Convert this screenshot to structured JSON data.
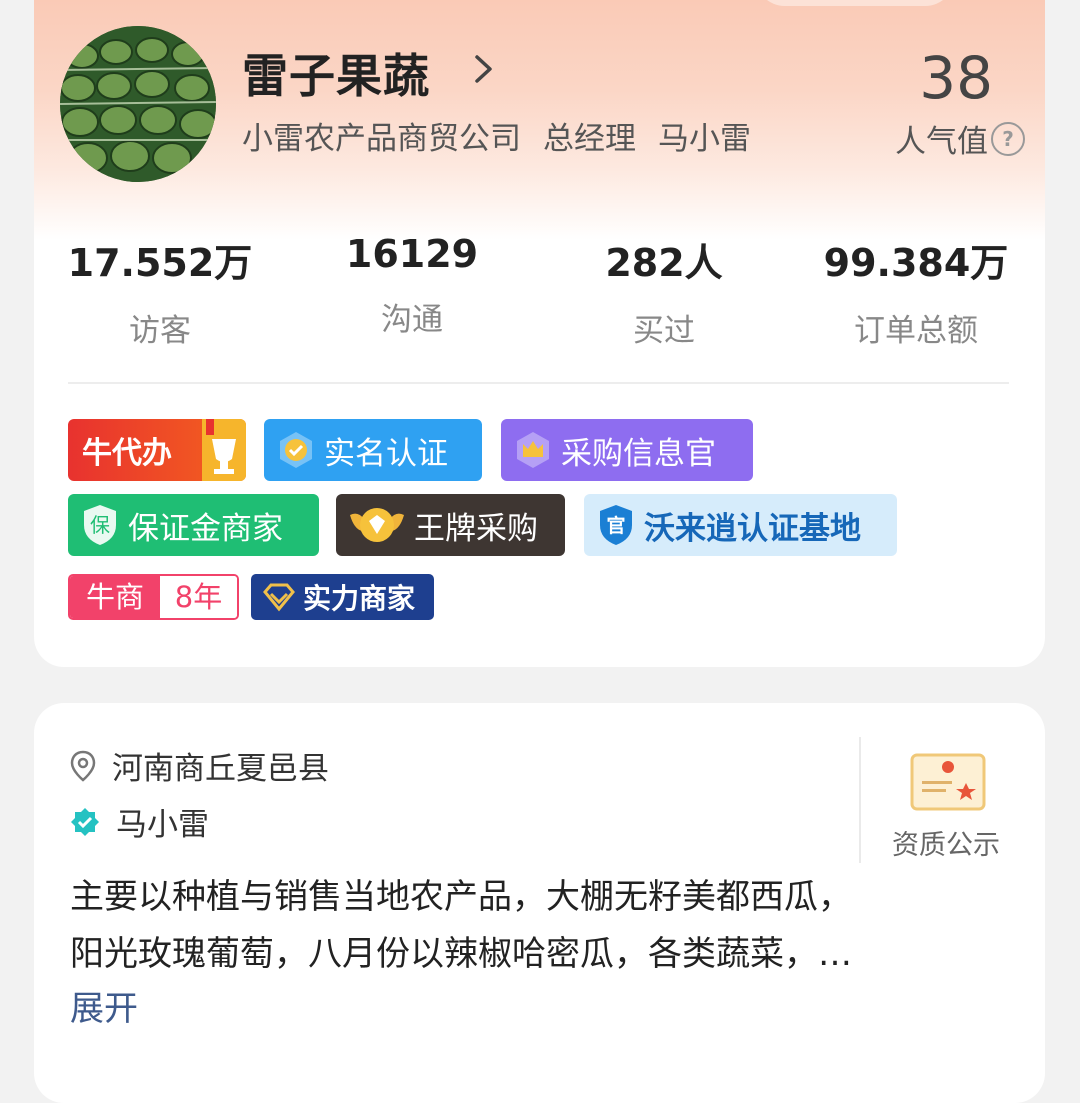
{
  "shop": {
    "name": "雷子果蔬",
    "company": "小雷农产品商贸公司",
    "position": "总经理",
    "owner": "马小雷",
    "popularity_value": "38",
    "popularity_label": "人气值"
  },
  "stats": [
    {
      "value": "17.552万",
      "label": "访客"
    },
    {
      "value": "16129",
      "label": "沟通"
    },
    {
      "value": "282人",
      "label": "买过"
    },
    {
      "value": "99.384万",
      "label": "订单总额"
    }
  ],
  "badges": {
    "niudaiban": "牛代办",
    "shiming": "实名认证",
    "caigou": "采购信息官",
    "baozheng": "保证金商家",
    "baozheng_icon_char": "保",
    "wangpai": "王牌采购",
    "wolai": "沃来逍认证基地",
    "wolai_icon_char": "官",
    "niushang": "牛商",
    "niushang_years": "8年",
    "shili": "实力商家"
  },
  "info": {
    "location": "河南商丘夏邑县",
    "verified_name": "马小雷",
    "cert_label": "资质公示",
    "description_line1": "主要以种植与销售当地农产品，大棚无籽美都西瓜，",
    "description_line2": "阳光玫瑰葡萄，八月份以辣椒哈密瓜，各类蔬菜，…",
    "expand_label": "展开"
  },
  "colors": {
    "header_gradient_top": "#f9c6b1",
    "niudaiban": "#e8322f",
    "shiming": "#2fa1f2",
    "caigou": "#8e6df0",
    "baozheng": "#1fbe74",
    "wangpai": "#3e3632",
    "wolai_bg": "#d6ecfb",
    "niushang": "#f2426a",
    "shili": "#1e3f8f",
    "expand_link": "#3e5a8c"
  },
  "icons": [
    "watermelon-avatar",
    "chevron-right-icon",
    "question-circle-icon",
    "shield-check-icon",
    "crown-icon",
    "shield-bao-icon",
    "diamond-wings-icon",
    "shield-guan-icon",
    "diamond-icon",
    "location-pin-icon",
    "verified-badge-icon",
    "certificate-icon"
  ]
}
